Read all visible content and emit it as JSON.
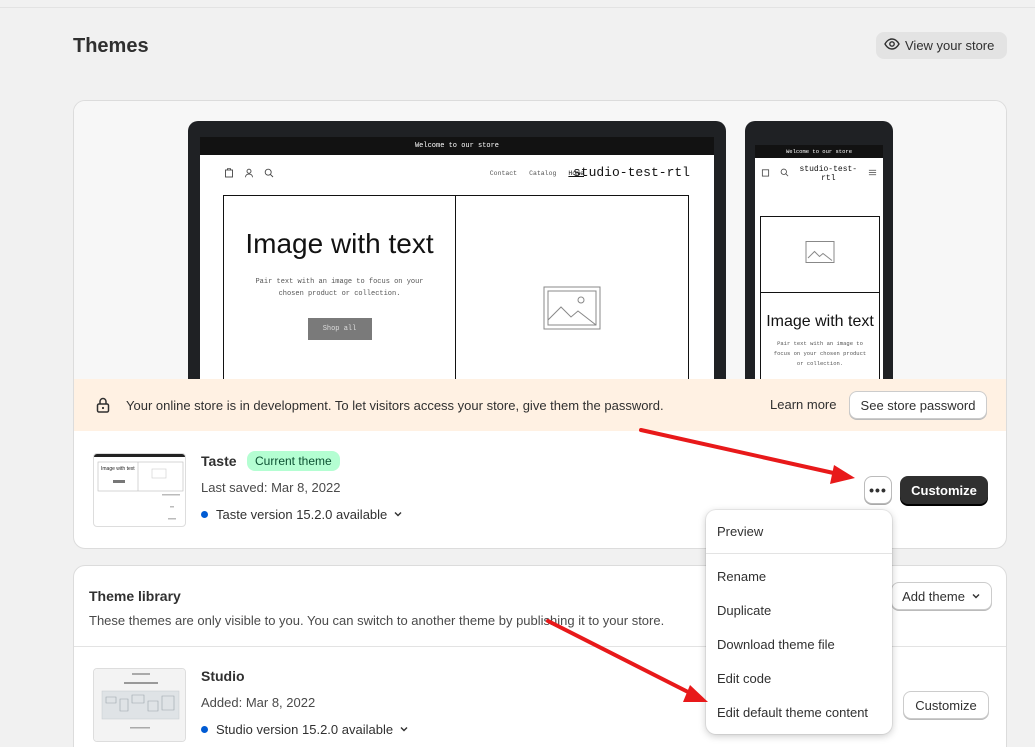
{
  "header": {
    "title": "Themes",
    "view_store_label": "View your store"
  },
  "preview": {
    "announcement": "Welcome to our store",
    "nav_links": [
      "Contact",
      "Catalog",
      "Home"
    ],
    "brand": "studio-test-rtl",
    "hero_title": "Image with text",
    "hero_text": "Pair text with an image to focus on your chosen product or collection.",
    "hero_button": "Shop all",
    "phone_hero_title": "Image with text",
    "phone_hero_text": "Pair text with an image to focus on your chosen product or collection."
  },
  "banner": {
    "message": "Your online store is in development. To let visitors access your store, give them the password.",
    "learn_more": "Learn more",
    "password_button": "See store password"
  },
  "current_theme": {
    "name": "Taste",
    "badge": "Current theme",
    "saved": "Last saved: Mar 8, 2022",
    "version": "Taste version 15.2.0 available",
    "actions_icon": "•••",
    "customize_label": "Customize",
    "thumb_text": "Image with text"
  },
  "library": {
    "title": "Theme library",
    "description": "These themes are only visible to you. You can switch to another theme by publishing it to your store.",
    "add_theme_label": "Add theme",
    "themes": [
      {
        "name": "Studio",
        "added": "Added: Mar 8, 2022",
        "version": "Studio version 15.2.0 available",
        "customize_label": "Customize"
      }
    ]
  },
  "menu": {
    "items": [
      "Preview",
      "Rename",
      "Duplicate",
      "Download theme file",
      "Edit code",
      "Edit default theme content"
    ]
  },
  "colors": {
    "accent_dark": "#303030",
    "badge_bg": "#b4fed2",
    "banner_bg": "#fff1e3",
    "arrow": "#e8191a",
    "version_dot": "#005bd3"
  }
}
